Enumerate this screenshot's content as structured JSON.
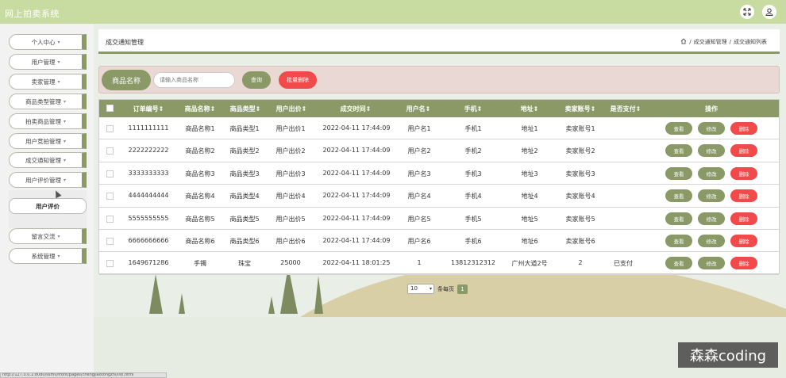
{
  "app": {
    "title": "网上拍卖系统"
  },
  "topbar": {
    "fullscreen_icon": "fullscreen-icon",
    "user_icon": "user-icon"
  },
  "sidebar": {
    "items": [
      {
        "label": "个人中心"
      },
      {
        "label": "用户管理"
      },
      {
        "label": "卖家管理"
      },
      {
        "label": "商品类型管理"
      },
      {
        "label": "拍卖商品管理"
      },
      {
        "label": "用户竞拍管理"
      },
      {
        "label": "成交通知管理"
      },
      {
        "label": "用户评价管理"
      },
      {
        "label": "留言交流"
      },
      {
        "label": "系统管理"
      }
    ],
    "submenu": {
      "label": "用户评价"
    }
  },
  "header": {
    "title": "成交通知管理",
    "breadcrumb": {
      "sep": "/",
      "level1": "成交通知管理",
      "level2": "成交通知列表"
    }
  },
  "search": {
    "label": "商品名称",
    "placeholder": "请输入商品名称",
    "query_button": "查询",
    "batch_delete_button": "批量删除"
  },
  "table": {
    "columns": {
      "order_no": "订单编号",
      "product_name": "商品名称",
      "product_type": "商品类型",
      "bid": "用户出价",
      "deal_time": "成交时间",
      "username": "用户名",
      "phone": "手机",
      "address": "地址",
      "seller": "卖家账号",
      "paid": "是否支付",
      "actions": "操作"
    },
    "actions": {
      "view": "查看",
      "edit": "修改",
      "delete": "删除"
    },
    "rows": [
      {
        "order_no": "1111111111",
        "product_name": "商品名称1",
        "product_type": "商品类型1",
        "bid": "用户出价1",
        "deal_time": "2022-04-11 17:44:09",
        "username": "用户名1",
        "phone": "手机1",
        "address": "地址1",
        "seller": "卖家账号1",
        "paid": ""
      },
      {
        "order_no": "2222222222",
        "product_name": "商品名称2",
        "product_type": "商品类型2",
        "bid": "用户出价2",
        "deal_time": "2022-04-11 17:44:09",
        "username": "用户名2",
        "phone": "手机2",
        "address": "地址2",
        "seller": "卖家账号2",
        "paid": ""
      },
      {
        "order_no": "3333333333",
        "product_name": "商品名称3",
        "product_type": "商品类型3",
        "bid": "用户出价3",
        "deal_time": "2022-04-11 17:44:09",
        "username": "用户名3",
        "phone": "手机3",
        "address": "地址3",
        "seller": "卖家账号3",
        "paid": ""
      },
      {
        "order_no": "4444444444",
        "product_name": "商品名称4",
        "product_type": "商品类型4",
        "bid": "用户出价4",
        "deal_time": "2022-04-11 17:44:09",
        "username": "用户名4",
        "phone": "手机4",
        "address": "地址4",
        "seller": "卖家账号4",
        "paid": ""
      },
      {
        "order_no": "5555555555",
        "product_name": "商品名称5",
        "product_type": "商品类型5",
        "bid": "用户出价5",
        "deal_time": "2022-04-11 17:44:09",
        "username": "用户名5",
        "phone": "手机5",
        "address": "地址5",
        "seller": "卖家账号5",
        "paid": ""
      },
      {
        "order_no": "6666666666",
        "product_name": "商品名称6",
        "product_type": "商品类型6",
        "bid": "用户出价6",
        "deal_time": "2022-04-11 17:44:09",
        "username": "用户名6",
        "phone": "手机6",
        "address": "地址6",
        "seller": "卖家账号6",
        "paid": ""
      },
      {
        "order_no": "1649671286",
        "product_name": "手镯",
        "product_type": "珠宝",
        "bid": "25000",
        "deal_time": "2022-04-11 18:01:25",
        "username": "1",
        "phone": "13812312312",
        "address": "广州大道2号",
        "seller": "2",
        "paid": "已支付"
      }
    ]
  },
  "pagination": {
    "page_size": "10",
    "per_page_label": "条每页",
    "current_page": "1"
  },
  "watermark": {
    "text": "森森coding"
  },
  "status_url": "http://127.0.0.1:8080/ssm0/front/pages/chengjiaotongzhi/list.html",
  "colors": {
    "accent": "#8a9966",
    "danger": "#f24a4a",
    "topbar": "#c8dca2",
    "search_bg": "#ead8d4"
  }
}
